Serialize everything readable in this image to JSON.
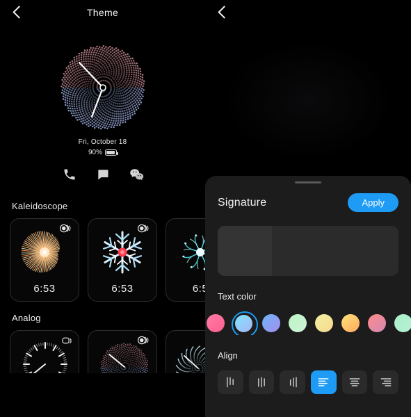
{
  "left": {
    "header": {
      "title": "Theme",
      "back_icon": "chevron-left-icon"
    },
    "preview": {
      "face_name": "spiral-dots-analog",
      "date": "Fri, October 18",
      "battery_percent": "90%",
      "battery_icon": "battery-icon",
      "shortcuts": [
        {
          "name": "phone-icon",
          "label": "Phone"
        },
        {
          "name": "message-icon",
          "label": "Messages"
        },
        {
          "name": "wechat-icon",
          "label": "WeChat"
        }
      ]
    },
    "sections": [
      {
        "title": "Kaleidoscope",
        "cards": [
          {
            "time": "6:53",
            "badge": "animated-circles-icon",
            "art": "burst-orange"
          },
          {
            "time": "6:53",
            "badge": "animated-circles-icon",
            "art": "snowflake-blue"
          },
          {
            "time": "6:5",
            "badge": "animated-circles-icon",
            "art": "kaleido-teal"
          }
        ]
      },
      {
        "title": "Analog",
        "cards": [
          {
            "time": "",
            "badge": "rounded-squares-icon",
            "art": "analog-ticks"
          },
          {
            "time": "",
            "badge": "animated-circles-icon",
            "art": "spiral-dots"
          },
          {
            "time": "",
            "badge": "",
            "art": "spiral-dots-teal"
          }
        ]
      }
    ]
  },
  "right": {
    "header": {
      "back_icon": "chevron-left-icon"
    },
    "sheet": {
      "title": "Signature",
      "apply_label": "Apply",
      "handle": "drag-handle",
      "text_color_label": "Text color",
      "align_label": "Align",
      "accent_color": "#1d9bf5",
      "swatches": [
        {
          "name": "swatch-pink",
          "from": "#ff7ba8",
          "to": "#ff5f8f",
          "selected": false
        },
        {
          "name": "swatch-cyan-blue",
          "from": "#7fe3ff",
          "to": "#a8b6f5",
          "selected": true
        },
        {
          "name": "swatch-blue-purple",
          "from": "#6fb5f7",
          "to": "#a48ef0",
          "selected": false
        },
        {
          "name": "swatch-mint",
          "from": "#bdf3c4",
          "to": "#cdf5d8",
          "selected": false
        },
        {
          "name": "swatch-yellow-green",
          "from": "#f2f0a0",
          "to": "#f6d98e",
          "selected": false
        },
        {
          "name": "swatch-orange",
          "from": "#ffe27a",
          "to": "#ffa95e",
          "selected": false
        },
        {
          "name": "swatch-pink-red",
          "from": "#ff8a8a",
          "to": "#d18ab4",
          "selected": false
        },
        {
          "name": "swatch-green-mint",
          "from": "#a8f0c8",
          "to": "#b6f0d4",
          "selected": false
        },
        {
          "name": "swatch-sky-blue",
          "from": "#6fc8f7",
          "to": "#5fb0f0",
          "selected": false
        }
      ],
      "align_options": [
        {
          "name": "align-vertical-right",
          "type": "vertical",
          "variant": "v1",
          "selected": false
        },
        {
          "name": "align-vertical-center",
          "type": "vertical",
          "variant": "v2",
          "selected": false
        },
        {
          "name": "align-vertical-left",
          "type": "vertical",
          "variant": "v3",
          "selected": false
        },
        {
          "name": "align-left",
          "type": "horizontal",
          "variant": "left",
          "selected": true
        },
        {
          "name": "align-center",
          "type": "horizontal",
          "variant": "center",
          "selected": false
        },
        {
          "name": "align-right",
          "type": "horizontal",
          "variant": "right",
          "selected": false
        }
      ]
    }
  }
}
